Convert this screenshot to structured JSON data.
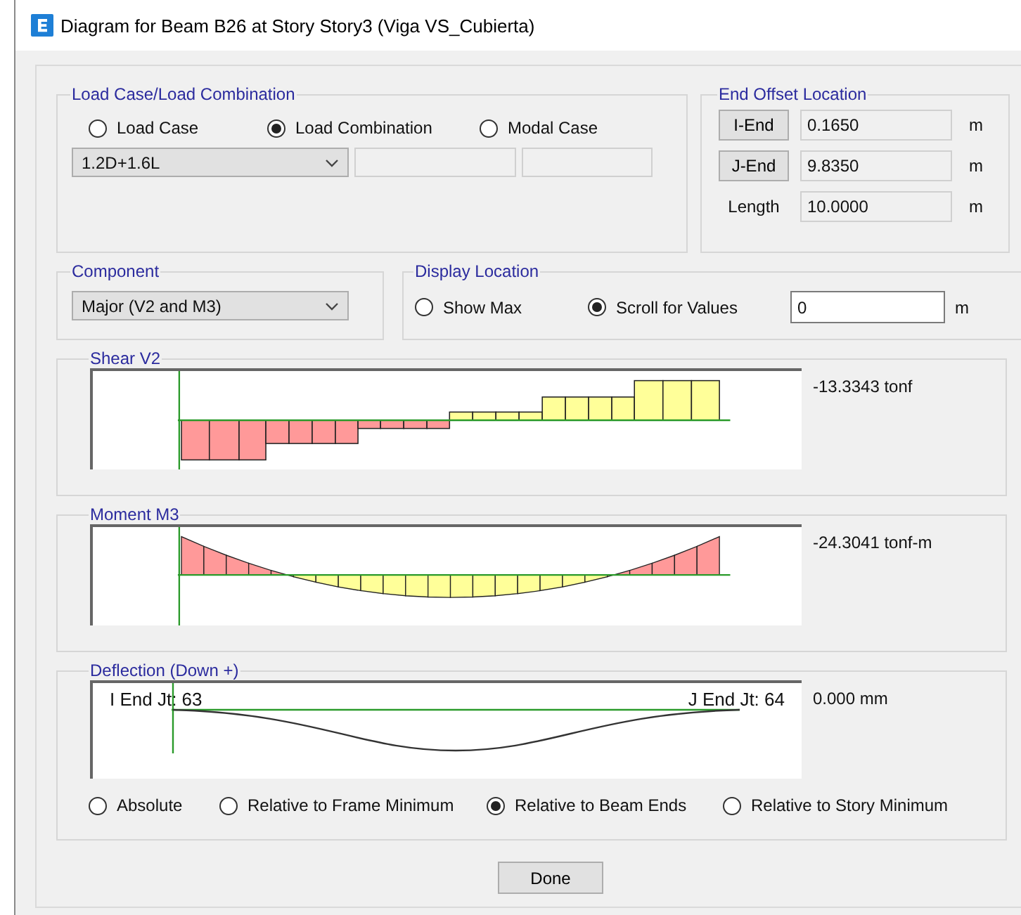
{
  "window": {
    "title": "Diagram for Beam B26 at Story Story3 (Viga VS_Cubierta)"
  },
  "load_case": {
    "legend": "Load Case/Load Combination",
    "options": [
      {
        "label": "Load Case",
        "selected": false
      },
      {
        "label": "Load Combination",
        "selected": true
      },
      {
        "label": "Modal Case",
        "selected": false
      }
    ],
    "combo": {
      "value": "1.2D+1.6L"
    }
  },
  "end_offset": {
    "legend": "End Offset Location",
    "rows": [
      {
        "kind": "button",
        "label": "I-End",
        "value": "0.1650",
        "unit": "m"
      },
      {
        "kind": "button",
        "label": "J-End",
        "value": "9.8350",
        "unit": "m"
      },
      {
        "kind": "label",
        "label": "Length",
        "value": "10.0000",
        "unit": "m"
      }
    ]
  },
  "component": {
    "legend": "Component",
    "value": "Major (V2 and M3)"
  },
  "display_location": {
    "legend": "Display Location",
    "options": [
      {
        "label": "Show Max",
        "selected": false
      },
      {
        "label": "Scroll for Values",
        "selected": true
      }
    ],
    "value": "0",
    "unit": "m"
  },
  "shear": {
    "legend": "Shear V2",
    "reading": "-13.3343 tonf"
  },
  "moment": {
    "legend": "Moment M3",
    "reading": "-24.3041 tonf-m"
  },
  "deflection": {
    "legend": "Deflection (Down +)",
    "i_end": "I End Jt: 63",
    "j_end": "J End Jt: 64",
    "reading": "0.000 mm",
    "options": [
      {
        "label": "Absolute",
        "selected": false
      },
      {
        "label": "Relative to Frame Minimum",
        "selected": false
      },
      {
        "label": "Relative to Beam Ends",
        "selected": true
      },
      {
        "label": "Relative to Story Minimum",
        "selected": false
      }
    ]
  },
  "done_button": "Done"
}
